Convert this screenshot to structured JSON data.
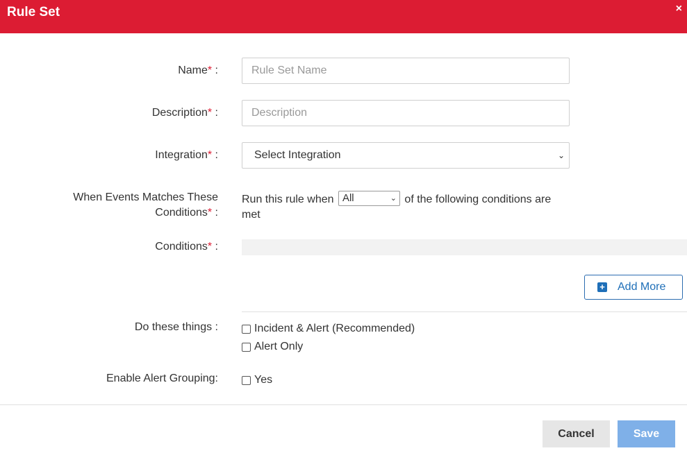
{
  "header": {
    "title": "Rule Set",
    "close_glyph": "×"
  },
  "form": {
    "name": {
      "label": "Name",
      "required": "*",
      "sep": " :",
      "placeholder": "Rule Set Name"
    },
    "description": {
      "label": "Description",
      "required": "*",
      "sep": " :",
      "placeholder": "Description"
    },
    "integration": {
      "label": "Integration",
      "required": "*",
      "sep": " :",
      "selected": "Select Integration"
    },
    "conditions_match": {
      "label_line1": "When Events Matches These",
      "label_line2": "Conditions",
      "required": "*",
      "sep": " :",
      "prefix": "Run this rule when",
      "selected": "All",
      "suffix": "of the following conditions are met"
    },
    "conditions": {
      "label": "Conditions",
      "required": "*",
      "sep": " :"
    },
    "add_more": {
      "label": "Add More",
      "icon": "plus-square-icon"
    },
    "actions": {
      "label": "Do these things :",
      "options": [
        {
          "label": "Incident & Alert (Recommended)",
          "checked": false
        },
        {
          "label": "Alert Only",
          "checked": false
        }
      ]
    },
    "alert_grouping": {
      "label": "Enable Alert Grouping:",
      "option": {
        "label": "Yes",
        "checked": false
      }
    }
  },
  "footer": {
    "cancel_label": "Cancel",
    "save_label": "Save"
  },
  "colors": {
    "header": "#dc1c33",
    "accent": "#1f6fb8",
    "save": "#7fb0e8",
    "required": "#dc1c33"
  }
}
